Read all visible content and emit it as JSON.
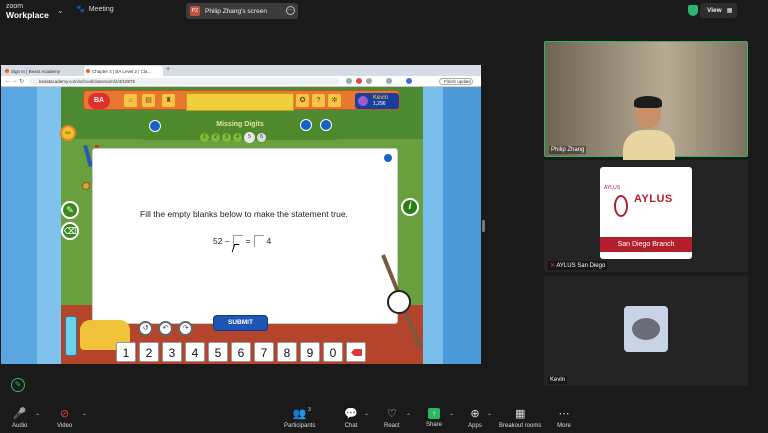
{
  "topbar": {
    "brand_line1": "zoom",
    "brand_line2": "Workplace",
    "meeting_label": "Meeting",
    "share_initials": "PZ",
    "share_label": "Philip Zhang's screen",
    "view_label": "View"
  },
  "browser": {
    "tabs": [
      "Sign In | Beast Academy",
      "Chapter 4 | BA Level 2 | Cla…"
    ],
    "url": "beastacademy.com/school/classroom/2/4/10875",
    "finish_update": "Finish update"
  },
  "game": {
    "player_name": "Kevin",
    "player_score": "1,296",
    "logo": "BA",
    "subtitle": "Missing Digits",
    "levels": [
      "1",
      "2",
      "3",
      "4",
      "5",
      "6"
    ],
    "current_level": 5,
    "prompt": "Fill the empty blanks below to make the statement true.",
    "equation": {
      "left": "52 –",
      "equals": "=",
      "right": "4"
    },
    "submit_label": "SUBMIT",
    "keypad": [
      "1",
      "2",
      "3",
      "4",
      "5",
      "6",
      "7",
      "8",
      "9",
      "0"
    ]
  },
  "participants": [
    {
      "name": "Philip Zhang"
    },
    {
      "name": "AYLUS San Diego",
      "muted": true,
      "logo_title": "AYLUS",
      "logo_branch": "San Diego Branch"
    },
    {
      "name": "Kevin"
    }
  ],
  "toolbar": {
    "audio": "Audio",
    "video": "Video",
    "participants": "Participants",
    "participants_count": "3",
    "chat": "Chat",
    "react": "React",
    "share": "Share",
    "apps": "Apps",
    "breakout": "Breakout rooms",
    "more": "More"
  },
  "colors": {
    "accent_green": "#2ab860",
    "muted_red": "#e23b3b",
    "bg": "#1a1a1a"
  }
}
